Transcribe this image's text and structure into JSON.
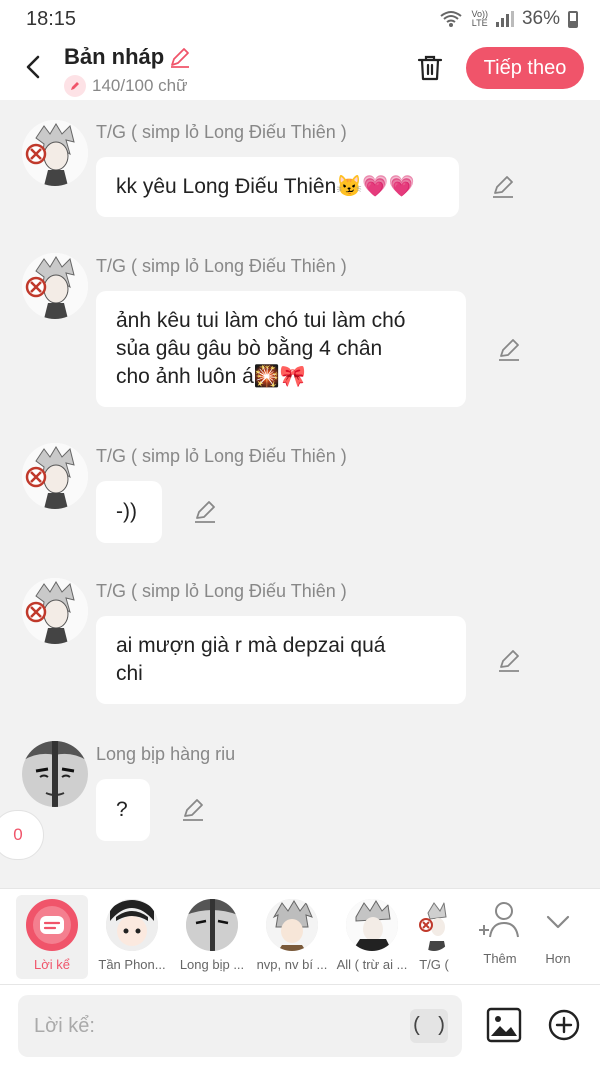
{
  "status": {
    "time": "18:15",
    "volte_top": "Vo))",
    "volte_bottom": "LTE",
    "battery": "36%"
  },
  "header": {
    "title": "Bản nháp",
    "word_count": "140/100 chữ",
    "next_label": "Tiếp theo"
  },
  "messages": [
    {
      "sender": "T/G ( simp lỏ Long Điếu Thiên )",
      "lines": [
        "kk yêu Long Điếu Thiên😼💗💗"
      ],
      "avatar": "tg"
    },
    {
      "sender": "T/G ( simp lỏ Long Điếu Thiên )",
      "lines": [
        "ảnh kêu tui làm chó tui làm chó",
        "sủa gâu gâu bò bằng 4 chân",
        "cho ảnh luôn á🎇🎀"
      ],
      "avatar": "tg"
    },
    {
      "sender": "T/G ( simp lỏ Long Điếu Thiên )",
      "lines": [
        "-))"
      ],
      "avatar": "tg"
    },
    {
      "sender": "T/G ( simp lỏ Long Điếu Thiên )",
      "lines": [
        "ai mượn già r mà depzai quá",
        "chi"
      ],
      "avatar": "tg"
    },
    {
      "sender": "Long bịp hàng riu",
      "lines": [
        "?"
      ],
      "avatar": "long"
    }
  ],
  "unread_count": "0",
  "speakers": [
    {
      "label": "Lời kể",
      "active": true
    },
    {
      "label": "Tần Phon...",
      "active": false
    },
    {
      "label": "Long bịp ...",
      "active": false
    },
    {
      "label": "nvp, nv bí ...",
      "active": false
    },
    {
      "label": "All ( trừ ai ...",
      "active": false
    },
    {
      "label": "T/G (",
      "active": false
    },
    {
      "label": "Thêm",
      "active": false
    },
    {
      "label": "Hơn",
      "active": false
    }
  ],
  "input": {
    "placeholder": "Lời kể:",
    "paren_label": "( )"
  },
  "colors": {
    "accent": "#f0546a",
    "background": "#f2f2f2",
    "bubble": "#ffffff"
  }
}
